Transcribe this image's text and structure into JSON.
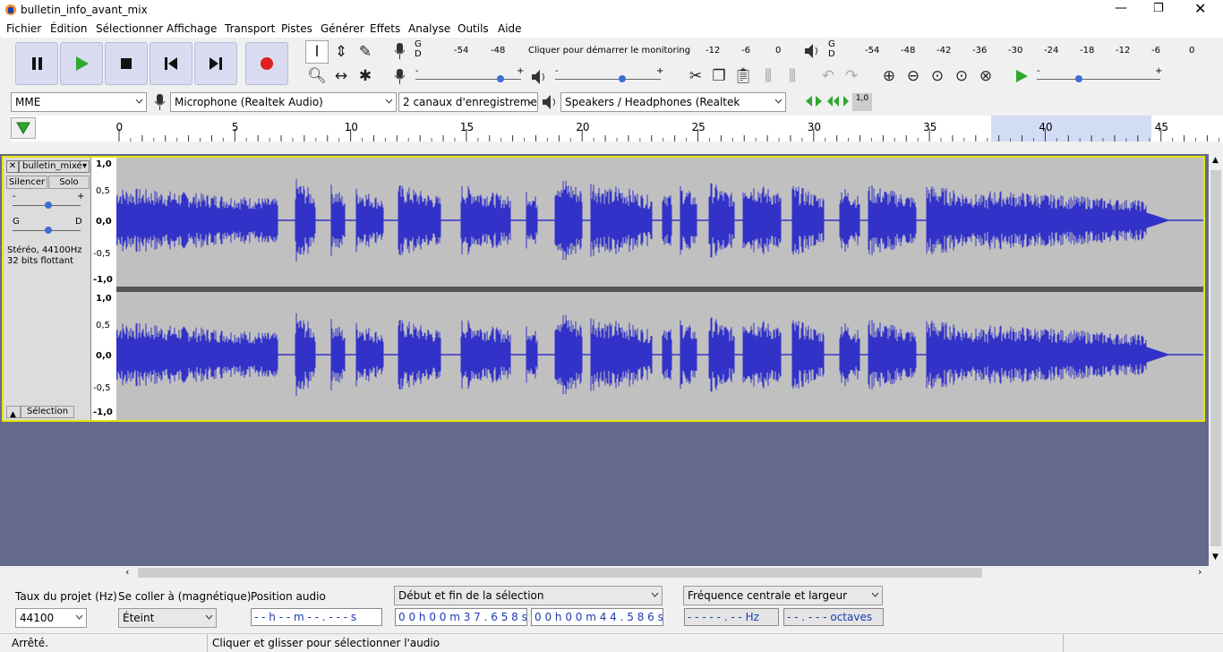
{
  "window": {
    "title": "bulletin_info_avant_mix"
  },
  "menu": [
    "Fichier",
    "Édition",
    "Sélectionner",
    "Affichage",
    "Transport",
    "Pistes",
    "Générer",
    "Effets",
    "Analyse",
    "Outils",
    "Aide"
  ],
  "meters": {
    "rec": {
      "lr": "G\nD",
      "ticks": [
        "-54",
        "-48",
        "Cliquer pour démarrer le monitoring",
        "-12",
        "-6",
        "0"
      ]
    },
    "play": {
      "lr": "G\nD",
      "ticks": [
        "-54",
        "-48",
        "-42",
        "-36",
        "-30",
        "-24",
        "-18",
        "-12",
        "-6",
        "0"
      ]
    }
  },
  "sliders": {
    "rec_minus": "-",
    "rec_plus": "+",
    "play_minus": "-",
    "play_plus": "+",
    "speed_minus": "-",
    "speed_plus": "+"
  },
  "devices": {
    "host": "MME",
    "mic": "Microphone (Realtek Audio)",
    "channels": "2 canaux d'enregistremen",
    "speakers": "Speakers / Headphones (Realtek"
  },
  "misc": {
    "sync_badge": "1,0"
  },
  "ruler": {
    "ticks": [
      "0",
      "5",
      "10",
      "15",
      "20",
      "25",
      "30",
      "35",
      "40",
      "45"
    ],
    "selection_start": 37.658,
    "selection_end": 44.586
  },
  "track": {
    "name": "bulletin_mixé",
    "mute": "Silencer",
    "solo": "Solo",
    "gain_minus": "-",
    "gain_plus": "+",
    "pan_left": "G",
    "pan_right": "D",
    "info1": "Stéréo, 44100Hz",
    "info2": "32 bits flottant",
    "select": "Sélection",
    "scale": [
      "1,0",
      "0,5",
      "0,0",
      "-0,5",
      "-1,0"
    ],
    "waveform_color": "#3232c8",
    "bg_color": "#c0c0c0"
  },
  "bottom": {
    "rate_label": "Taux du projet (Hz)",
    "rate_value": "44100",
    "snap_label": "Se coller à (magnétique)",
    "snap_value": "Éteint",
    "pos_label": "Position audio",
    "pos_value": "- - h - - m - - . - - - s",
    "sel_label": "Début et fin de la sélection",
    "sel_start": "0 0 h 0 0 m 3 7 . 6 5 8 s",
    "sel_end": "0 0 h 0 0 m 4 4 . 5 8 6 s",
    "freq_label": "Fréquence centrale et largeur",
    "freq_value": "- - - - - . - - Hz",
    "oct_value": "- - . - - - octaves"
  },
  "status": {
    "state": "Arrêté.",
    "hint": "Cliquer et glisser pour sélectionner l'audio"
  }
}
